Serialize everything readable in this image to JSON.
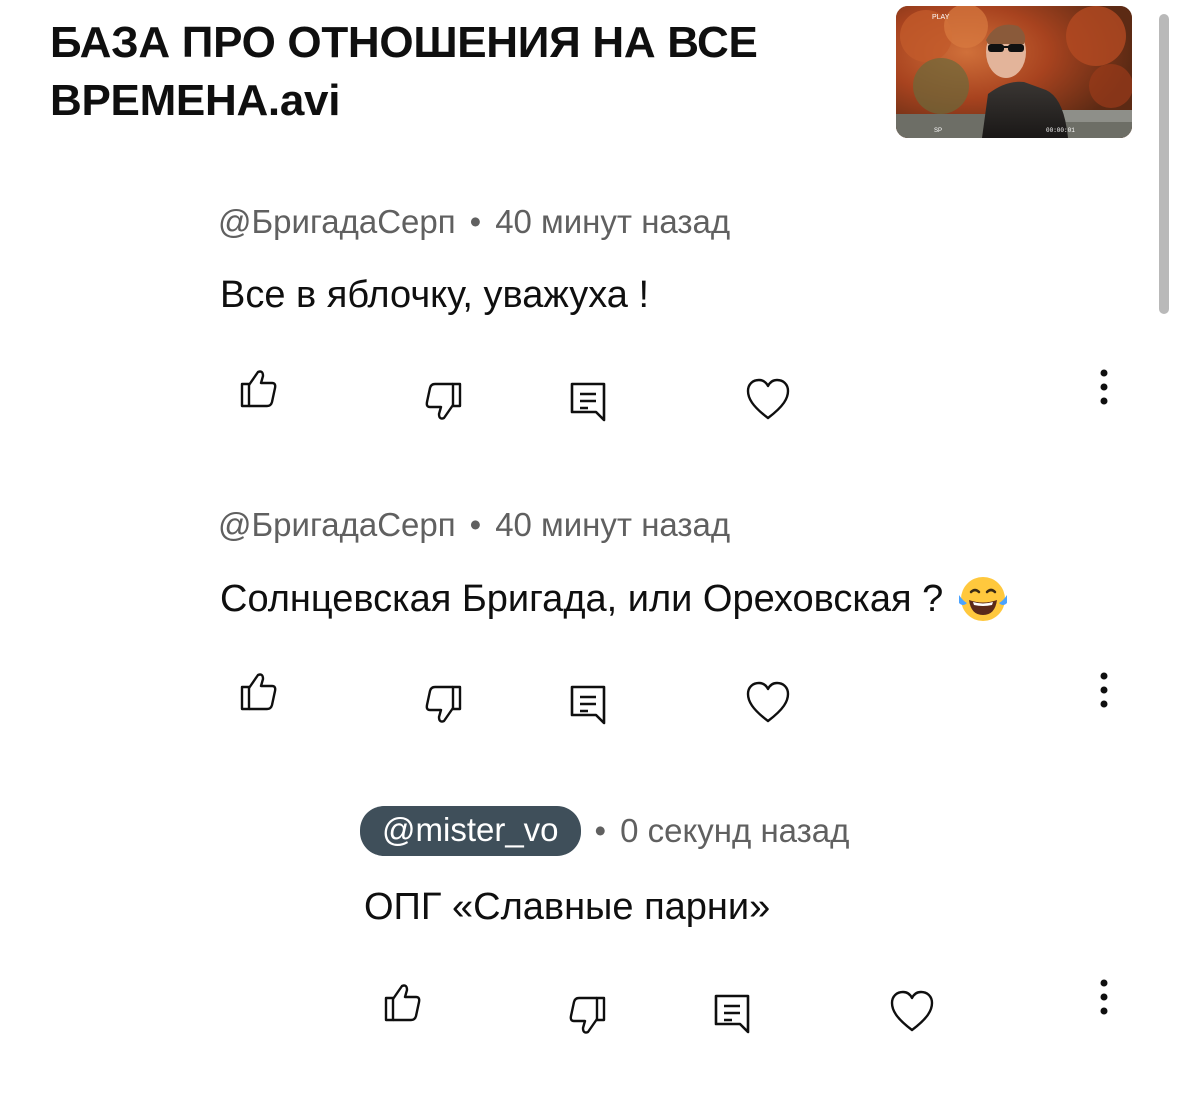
{
  "video": {
    "title_line1": "БАЗА ПРО ОТНОШЕНИЯ НА ВСЕ",
    "title_line2": "ВРЕМЕНА.avi",
    "thumbnail_text_top": "PLAY",
    "thumbnail_text_left": "SP",
    "thumbnail_timecode": "00:00:01"
  },
  "comments": [
    {
      "author": "@БригадаСерп",
      "separator": "•",
      "time": "40 минут назад",
      "text": "Все в яблочку, уважуха !",
      "emoji": ""
    },
    {
      "author": "@БригадаСерп",
      "separator": "•",
      "time": "40 минут назад",
      "text": "Солнцевская  Бригада, или Ореховская ?",
      "emoji": "laughing-tears-emoji"
    },
    {
      "author": "@mister_vo",
      "separator": "•",
      "time": "0 секунд назад",
      "text": "ОПГ «Славные парни»",
      "emoji": "",
      "author_highlighted": true
    }
  ],
  "actions": {
    "like_icon": "thumbs-up-icon",
    "dislike_icon": "thumbs-down-icon",
    "reply_icon": "comment-reply-icon",
    "heart_icon": "heart-icon",
    "more_icon": "more-vertical-icon"
  },
  "colors": {
    "meta_text": "#606060",
    "pill_bg": "#3f4f5a",
    "icon_stroke": "#0f0f0f"
  }
}
